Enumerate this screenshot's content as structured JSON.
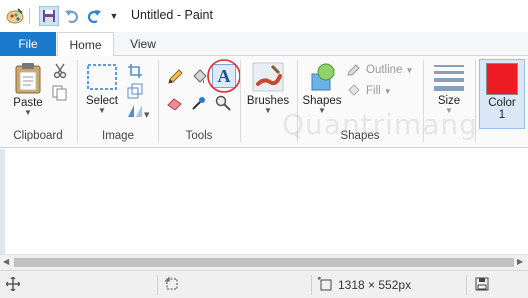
{
  "window": {
    "title": "Untitled - Paint"
  },
  "tabs": [
    {
      "label": "File"
    },
    {
      "label": "Home"
    },
    {
      "label": "View"
    }
  ],
  "ribbon": {
    "clipboard": {
      "paste_label": "Paste",
      "group_label": "Clipboard"
    },
    "image": {
      "select_label": "Select",
      "group_label": "Image"
    },
    "tools": {
      "group_label": "Tools"
    },
    "brushes": {
      "label": "Brushes"
    },
    "shapes": {
      "label": "Shapes",
      "outline_label": "Outline",
      "fill_label": "Fill",
      "group_label": "Shapes"
    },
    "size": {
      "label": "Size"
    },
    "color1": {
      "label": "Color",
      "number": "1",
      "swatch": "#ed1c24"
    }
  },
  "status": {
    "dimensions": "1318 × 552px"
  },
  "colors": {
    "accent": "#1979ca",
    "highlight_circle": "#e0282e"
  },
  "watermark": "Quantrimang"
}
